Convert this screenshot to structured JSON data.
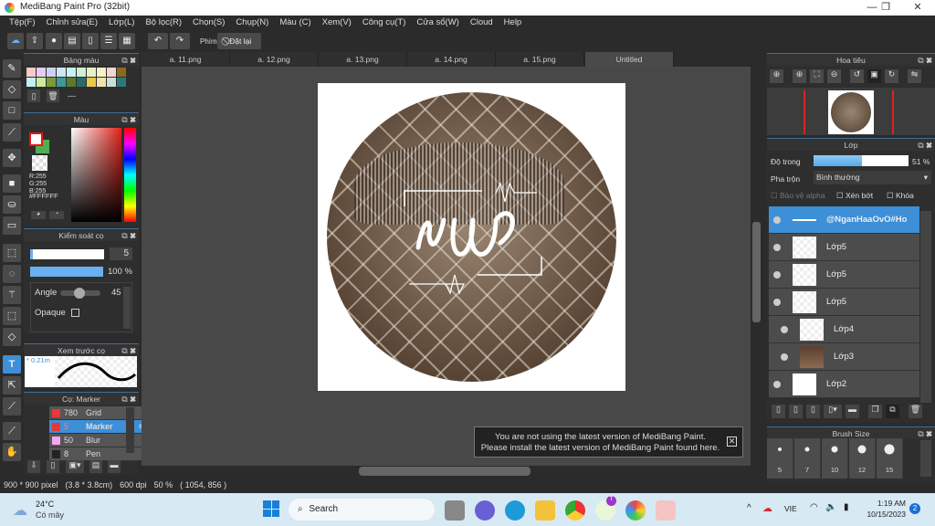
{
  "window": {
    "title": "MediBang Paint Pro (32bit)",
    "min": "—",
    "max": "❐",
    "close": "✕"
  },
  "menu": [
    "Tệp(F)",
    "Chỉnh sửa(E)",
    "Lớp(L)",
    "Bộ lọc(R)",
    "Chọn(S)",
    "Chụp(N)",
    "Màu (C)",
    "Xem(V)",
    "Công cụ(T)",
    "Cửa sổ(W)",
    "Cloud",
    "Help"
  ],
  "toolbar": {
    "shortcut_label": "Phím",
    "reset_label": "Đặt lại"
  },
  "tabs": [
    "a. 11.png",
    "a. 12.png",
    "a. 13.png",
    "a. 14.png",
    "a. 15.png",
    "Untitled"
  ],
  "palette": {
    "title": "Bảng màu",
    "colors": [
      "#f7c9c9",
      "#e3cdf0",
      "#cfd0f5",
      "#cde7f7",
      "#c9f1f1",
      "#cdf0d6",
      "#e7f2c9",
      "#f7f0c6",
      "#f3d6cf",
      "#8a6a1a",
      "#bff1ee",
      "#c9eb9a",
      "#7e9a37",
      "#3a9a98",
      "#5b7a2a",
      "#2a6a6a",
      "#e9c94a",
      "#f1e2ad",
      "#c9dfd9",
      "#2b7a7a"
    ],
    "separator": "---"
  },
  "color": {
    "title": "Màu",
    "primary": "#FFFFFF",
    "secondary": "#4caf50",
    "r": "R:255",
    "g": "G:255",
    "b": "B:255",
    "hex": "#FFFFFF"
  },
  "brush_control": {
    "title": "Kiểm soát cọ",
    "size": "5",
    "opacity": "100 %",
    "opacity_value": 100,
    "angle_label": "Angle",
    "angle": "45",
    "opaque_label": "Opaque"
  },
  "brush_preview": {
    "title": "Xem trước cọ",
    "size": "* 0.21m"
  },
  "brushes": {
    "title": "Cọ: Marker",
    "items": [
      {
        "value": "780",
        "name": "Grid",
        "color": "#e53935"
      },
      {
        "value": "5",
        "name": "Marker",
        "color": "#e53935",
        "selected": true
      },
      {
        "value": "50",
        "name": "Blur",
        "color": "#f4a6f0"
      },
      {
        "value": "8",
        "name": "Pen",
        "color": "#222222"
      }
    ]
  },
  "navigator": {
    "title": "Hoa tiêu"
  },
  "layers": {
    "title": "Lớp",
    "opacity_label": "Độ trong",
    "opacity": "51 %",
    "opacity_value": 51,
    "blend_label": "Pha trộn",
    "blend": "Bình thường",
    "protect_alpha": "Bảo vệ alpha",
    "clip": "Xén bớt",
    "lock": "Khóa",
    "items": [
      {
        "name": "@NganHaaOvO#Ho",
        "selected": true
      },
      {
        "name": "Lớp5"
      },
      {
        "name": "Lớp5"
      },
      {
        "name": "Lớp5"
      },
      {
        "name": "Lớp4"
      },
      {
        "name": "Lớp3"
      },
      {
        "name": "Lớp2"
      }
    ]
  },
  "brush_size": {
    "title": "Brush Size",
    "sizes": [
      "5",
      "7",
      "10",
      "12",
      "15"
    ]
  },
  "notification": {
    "line1": "You are not using the latest version of MediBang Paint.",
    "line2": "Please install the latest version of MediBang Paint found here."
  },
  "status": {
    "dimensions": "900 * 900 pixel",
    "physical": "(3.8 * 3.8cm)",
    "dpi": "600 dpi",
    "zoom": "50 %",
    "coords": "( 1054, 856 )"
  },
  "taskbar": {
    "temp": "24°C",
    "weather": "Có mây",
    "search": "Search",
    "lang": "VIE",
    "time": "1:19 AM",
    "date": "10/15/2023",
    "notif_count": "2",
    "badge": "T"
  }
}
